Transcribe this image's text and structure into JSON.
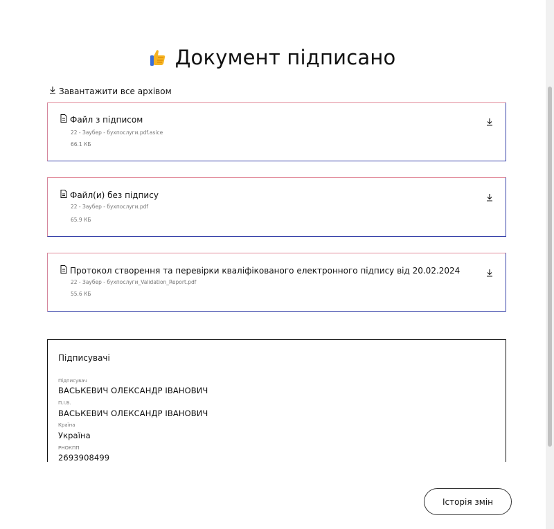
{
  "header": {
    "title": "Документ підписано",
    "title_icon": "👍"
  },
  "download_all": {
    "label": "Завантажити все архівом",
    "icon": "download-icon"
  },
  "files": [
    {
      "name": "Файл з підписом",
      "filename": "22 - Заубер - бухпослуги.pdf.asice",
      "size": "66.1 КБ"
    },
    {
      "name": "Файл(и) без підпису",
      "filename": "22 - Заубер - бухпослуги.pdf",
      "size": "65.9 КБ"
    },
    {
      "name": "Протокол створення та перевірки кваліфікованого електронного підпису від 20.02.2024",
      "filename": "22 - Заубер - бухпослуги_Validation_Report.pdf",
      "size": "55.6 КБ"
    }
  ],
  "signers": {
    "heading": "Підписувачі",
    "fields": [
      {
        "label": "Підписувач",
        "value": "ВАСЬКЕВИЧ ОЛЕКСАНДР ІВАНОВИЧ"
      },
      {
        "label": "П.І.Б.",
        "value": "ВАСЬКЕВИЧ ОЛЕКСАНДР ІВАНОВИЧ"
      },
      {
        "label": "Країна",
        "value": "Україна"
      },
      {
        "label": "РНОКПП",
        "value": "2693908499"
      }
    ]
  },
  "history_button": {
    "label": "Історія змін"
  },
  "colors": {
    "card_border": "#3540a8",
    "card_accent": "#e28a9a",
    "thumb_icon": "#f5b323"
  }
}
